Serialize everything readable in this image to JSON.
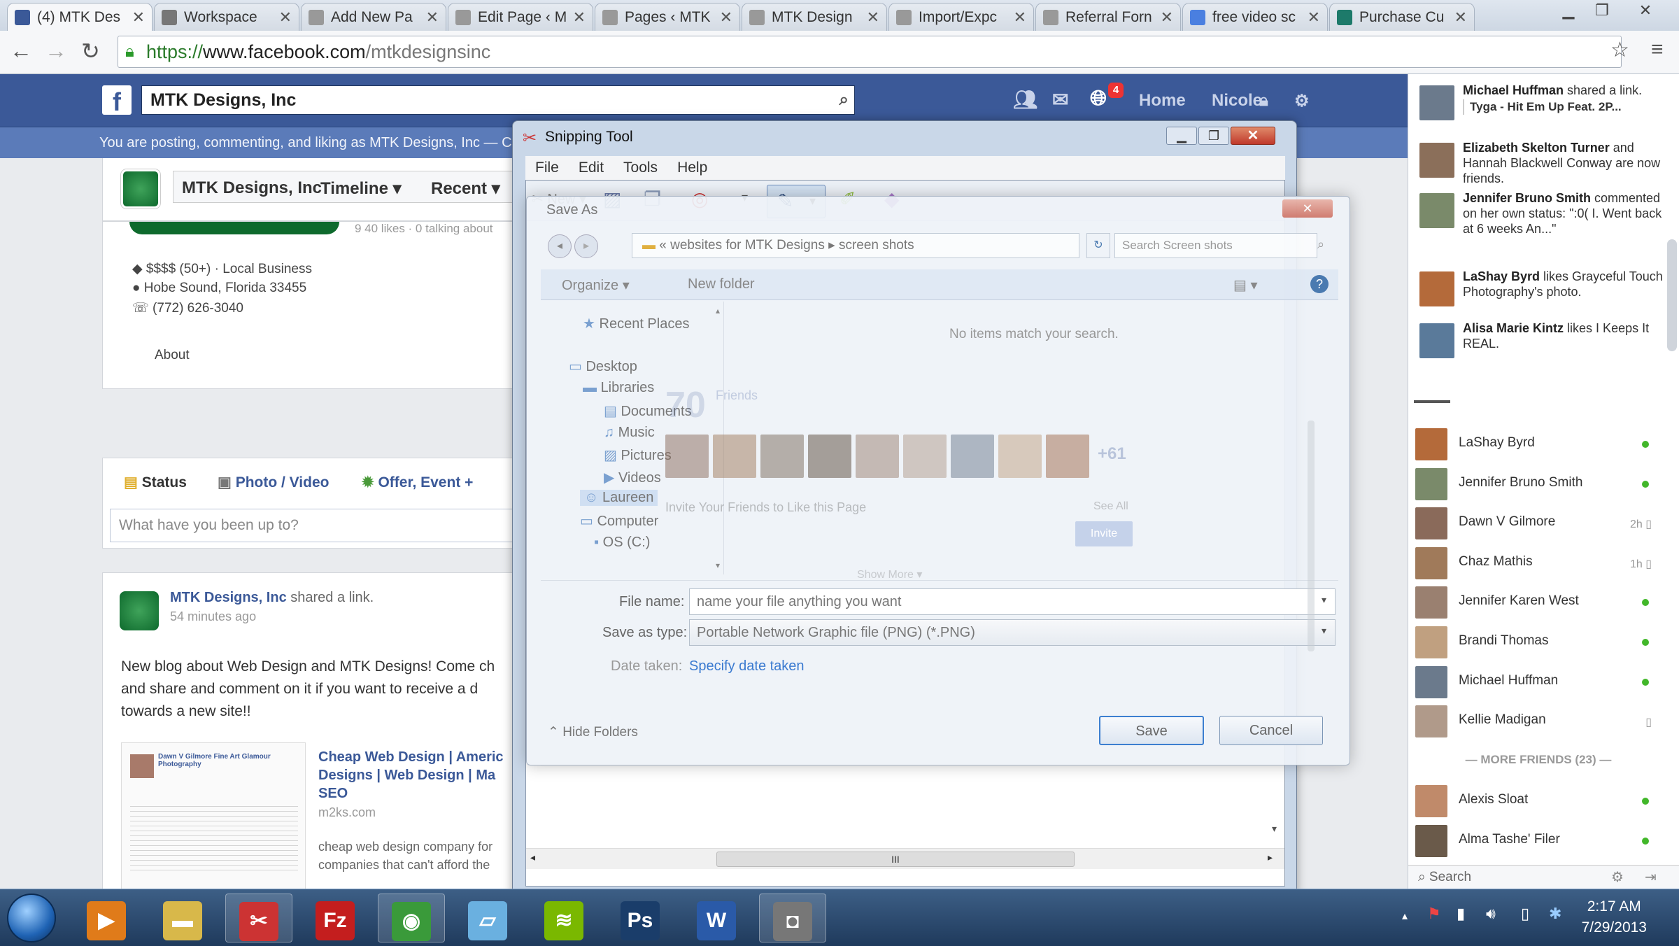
{
  "browser": {
    "tabs": [
      {
        "title": "(4) MTK Des",
        "icon": "facebook-icon",
        "color": "#3b5998"
      },
      {
        "title": "Workspace",
        "icon": "gear-icon",
        "color": "#777777"
      },
      {
        "title": "Add New Pa",
        "icon": "page-icon",
        "color": "#999999"
      },
      {
        "title": "Edit Page ‹ M",
        "icon": "page-icon",
        "color": "#999999"
      },
      {
        "title": "Pages ‹ MTK",
        "icon": "page-icon",
        "color": "#999999"
      },
      {
        "title": "MTK Design",
        "icon": "page-icon",
        "color": "#999999"
      },
      {
        "title": "Import/Expc",
        "icon": "page-icon",
        "color": "#999999"
      },
      {
        "title": "Referral Forn",
        "icon": "page-icon",
        "color": "#999999"
      },
      {
        "title": "free video sc",
        "icon": "google-icon",
        "color": "#4a7fe0"
      },
      {
        "title": "Purchase Cu",
        "icon": "xing-icon",
        "color": "#1d7a6a"
      }
    ],
    "url_scheme": "https://",
    "url_host": "www.facebook.com",
    "url_path": "/mtkdesignsinc"
  },
  "fb_header": {
    "search_value": "MTK Designs, Inc",
    "notif_count": "4",
    "nav_home": "Home",
    "nav_user": "Nicole",
    "posting_as": "You are posting, commenting, and liking as MTK Designs, Inc — Chan"
  },
  "page": {
    "name": "MTK Designs, Inc",
    "tab_timeline": "Timeline",
    "tab_recent": "Recent",
    "likes_snippet": "9 40 likes · 0 talking about",
    "price_category": "$$$$ (50+) · Local Business",
    "address": "Hobe Sound, Florida 33455",
    "phone": "(772) 626-3040",
    "about": "About",
    "composer_status": "Status",
    "composer_photo": "Photo / Video",
    "composer_offer": "Offer, Event +",
    "composer_placeholder": "What have you been up to?",
    "post_author": "MTK Designs, Inc",
    "post_action": " shared a link.",
    "post_time": "54 minutes ago",
    "post_text": "New blog about Web Design and MTK Designs! Come ch and share and comment on it if you want to receive a d towards a new site!!",
    "link_title": "Cheap Web Design | Americ Designs | Web Design | Ma SEO",
    "link_domain": "m2ks.com",
    "link_desc": "cheap web design company for companies that can't afford the",
    "link_thumb_name": "Dawn V Gilmore Fine Art Glamour Photography",
    "like_count": "70",
    "like_label": "Friends",
    "more_count": "+61",
    "invite_text": "Invite Your Friends to Like this Page",
    "see_all": "See All",
    "invite_btn": "Invite",
    "show_more": "Show More ▾"
  },
  "chat": {
    "ticker": [
      {
        "name": "Michael Huffman",
        "text": " shared a link.",
        "extra": "Tyga - Hit Em Up Feat. 2P...",
        "color": "#6b7a8c"
      },
      {
        "name": "Elizabeth Skelton Turner",
        "text": " and Hannah Blackwell Conway are now friends.",
        "extra": "",
        "color": "#8b6f5a"
      },
      {
        "name": "Jennifer Bruno Smith",
        "text": " commented on her own status: \":0( I. Went back at 6 weeks An...\"",
        "extra": "",
        "color": "#7a8a6a"
      },
      {
        "name": "LaShay Byrd",
        "text": " likes Grayceful Touch Photography's photo.",
        "extra": "",
        "color": "#b46a3a"
      },
      {
        "name": "Alisa Marie Kintz",
        "text": " likes I Keeps It REAL.",
        "extra": "",
        "color": "#5a7a9a"
      }
    ],
    "friends": [
      {
        "name": "LaShay Byrd",
        "status": "",
        "online": true,
        "color": "#b46a3a"
      },
      {
        "name": "Jennifer Bruno Smith",
        "status": "",
        "online": true,
        "color": "#7a8a6a"
      },
      {
        "name": "Dawn V Gilmore",
        "status": "2h",
        "online": false,
        "color": "#8a6a5a"
      },
      {
        "name": "Chaz Mathis",
        "status": "1h",
        "online": false,
        "color": "#a07a5a"
      },
      {
        "name": "Jennifer Karen West",
        "status": "",
        "online": true,
        "color": "#9a8070"
      },
      {
        "name": "Brandi Thomas",
        "status": "",
        "online": true,
        "color": "#c0a080"
      },
      {
        "name": "Michael Huffman",
        "status": "",
        "online": true,
        "color": "#6b7a8c"
      },
      {
        "name": "Kellie Madigan",
        "status": "",
        "online": false,
        "color": "#b09a8a"
      }
    ],
    "more_friends": "MORE FRIENDS (23)",
    "more_list": [
      {
        "name": "Alexis Sloat",
        "online": true,
        "color": "#c08a6a"
      },
      {
        "name": "Alma Tashe' Filer",
        "online": true,
        "color": "#6a5a4a"
      }
    ],
    "search_label": "Search"
  },
  "snipping": {
    "title": "Snipping Tool",
    "menu": [
      "File",
      "Edit",
      "Tools",
      "Help"
    ],
    "new_label": "New",
    "hscroll": "III"
  },
  "saveas": {
    "title": "Save As",
    "path_prefix": "«",
    "path1": "websites for MTK Designs",
    "path2": "screen shots",
    "search_placeholder": "Search Screen shots",
    "organize": "Organize ▾",
    "new_folder": "New folder",
    "empty_msg": "No items match your search.",
    "tree": [
      "Recent Places",
      "Desktop",
      "Libraries",
      "Documents",
      "Music",
      "Pictures",
      "Videos",
      "Laureen",
      "Computer",
      "OS (C:)"
    ],
    "file_name_label": "File name:",
    "file_name_value": "name your file anything you want",
    "save_type_label": "Save as type:",
    "save_type_value": "Portable Network Graphic file (PNG) (*.PNG)",
    "date_label": "Date taken:",
    "date_value": "Specify date taken",
    "hide_folders": "Hide Folders",
    "save_btn": "Save",
    "cancel_btn": "Cancel"
  },
  "taskbar": {
    "time": "2:17 AM",
    "date": "7/29/2013",
    "apps": [
      {
        "name": "media-player-icon",
        "glyph": "▶",
        "color": "#e07b1a"
      },
      {
        "name": "explorer-icon",
        "glyph": "▬",
        "color": "#d8b84a"
      },
      {
        "name": "snipping-tool-icon",
        "glyph": "✂",
        "color": "#c33"
      },
      {
        "name": "filezilla-icon",
        "glyph": "Fz",
        "color": "#c41e1e"
      },
      {
        "name": "chrome-icon",
        "glyph": "◉",
        "color": "#3a9a3a"
      },
      {
        "name": "notepad-icon",
        "glyph": "▱",
        "color": "#6ab0e0"
      },
      {
        "name": "spotify-icon",
        "glyph": "≋",
        "color": "#7ab800"
      },
      {
        "name": "photoshop-icon",
        "glyph": "Ps",
        "color": "#1a3d6a"
      },
      {
        "name": "word-icon",
        "glyph": "W",
        "color": "#2a5aa8"
      },
      {
        "name": "camera-icon",
        "glyph": "◘",
        "color": "#777777"
      }
    ]
  },
  "colors": {
    "fb_blue": "#3b5998",
    "online": "#42b72a",
    "notification": "#e33333"
  }
}
